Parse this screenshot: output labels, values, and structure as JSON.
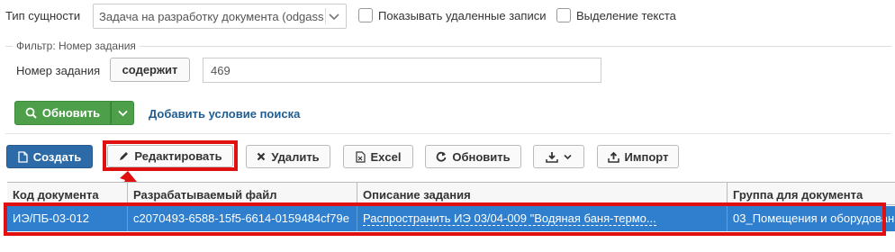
{
  "entity": {
    "label": "Тип сущности",
    "select_value": "Задача на разработку документа (odgass"
  },
  "checkboxes": {
    "show_deleted": "Показывать удаленные записи",
    "text_selection": "Выделение текста"
  },
  "filter": {
    "legend": "Фильтр: Номер задания",
    "field_label": "Номер задания",
    "operator": "содержит",
    "value": "469"
  },
  "actions": {
    "refresh_label": "Обновить",
    "add_condition": "Добавить условие поиска"
  },
  "toolbar": {
    "create": "Создать",
    "edit": "Редактировать",
    "delete": "Удалить",
    "excel": "Excel",
    "refresh": "Обновить",
    "import": "Импорт"
  },
  "grid": {
    "columns": [
      "Код документа",
      "Разрабатываемый файл",
      "Описание задания",
      "Группа для документа"
    ],
    "rows": [
      [
        "ИЭ/ПБ-03-012",
        "c2070493-6588-15f5-6614-0159484cf79e",
        "Распространить ИЭ 03/04-009 \"Водяная баня-термо...",
        "03_Помещения и оборудован"
      ]
    ]
  },
  "colors": {
    "accent_blue": "#2d6ba8",
    "accent_green": "#4d9f49",
    "highlight_red": "#e01010",
    "selected_row": "#2f7fce"
  }
}
